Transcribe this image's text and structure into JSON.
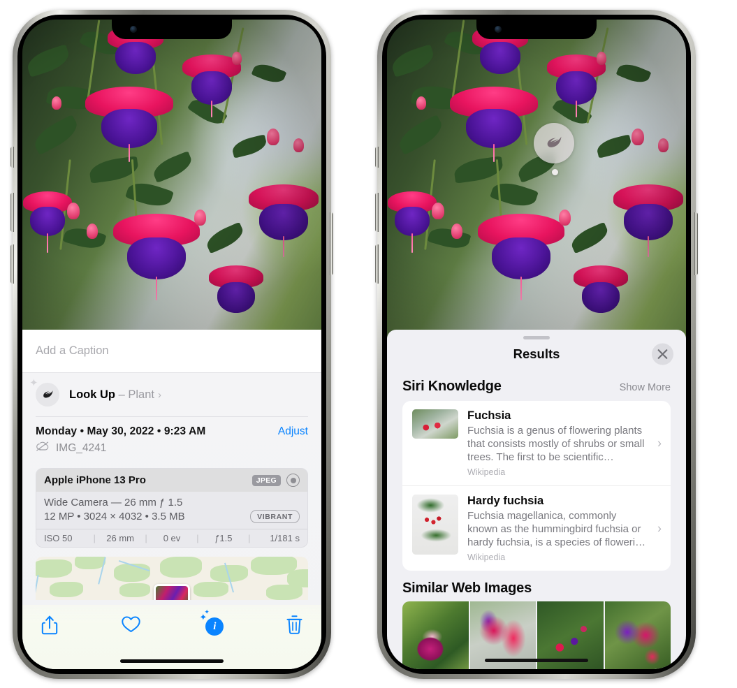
{
  "left_phone": {
    "caption_placeholder": "Add a Caption",
    "lookup": {
      "label": "Look Up",
      "dash": "–",
      "subject": "Plant",
      "chevron": "›",
      "icon": "leaf-icon"
    },
    "meta": {
      "date": "Monday • May 30, 2022 • 9:23 AM",
      "adjust": "Adjust",
      "filename": "IMG_4241",
      "cloud_icon": "cloud-slash-icon"
    },
    "exif": {
      "device": "Apple iPhone 13 Pro",
      "format_badge": "JPEG",
      "raw_icon": "aperture-icon",
      "lens": "Wide Camera — 26 mm ƒ 1.5",
      "size_line": "12 MP • 3024 × 4032 • 3.5 MB",
      "style_badge": "VIBRANT",
      "stats": [
        "ISO 50",
        "26 mm",
        "0 ev",
        "ƒ1.5",
        "1/181 s"
      ],
      "separator": "|"
    },
    "toolbar": {
      "share_icon": "share-icon",
      "favorite_icon": "heart-icon",
      "info_icon": "info-sparkle-icon",
      "info_glyph": "i",
      "delete_icon": "trash-icon"
    }
  },
  "right_phone": {
    "vlu_badge_icon": "leaf-icon",
    "sheet": {
      "title": "Results",
      "close_icon": "close-icon",
      "sections": [
        {
          "title": "Siri Knowledge",
          "action": "Show More",
          "items": [
            {
              "title": "Fuchsia",
              "description": "Fuchsia is a genus of flowering plants that consists mostly of shrubs or small trees. The first to be scientific…",
              "source": "Wikipedia",
              "chevron": "›"
            },
            {
              "title": "Hardy fuchsia",
              "description": "Fuchsia magellanica, commonly known as the hummingbird fuchsia or hardy fuchsia, is a species of floweri…",
              "source": "Wikipedia",
              "chevron": "›"
            }
          ]
        },
        {
          "title": "Similar Web Images",
          "action": ""
        }
      ]
    }
  },
  "colors": {
    "accent_blue": "#0a84ff",
    "sheet_bg": "#f0f0f4",
    "card_bg": "#ffffff",
    "secondary_text": "#79797f",
    "tertiary_text": "#adadb3"
  }
}
